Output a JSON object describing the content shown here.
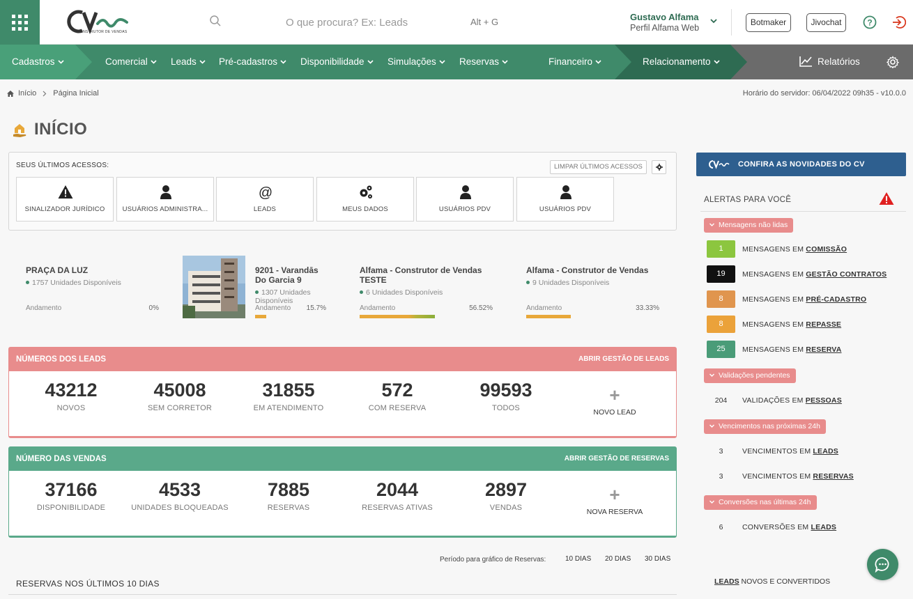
{
  "header": {
    "search_placeholder": "O que procura? Ex: Leads",
    "shortcut": "Alt + G",
    "user_name": "Gustavo Alfama",
    "user_profile": "Perfil Alfama Web",
    "botmaker_label": "Botmaker",
    "jivochat_label": "Jivochat",
    "logo_sub": "CONSTRUTOR DE VENDAS"
  },
  "nav": {
    "items": [
      "Cadastros",
      "Comercial",
      "Leads",
      "Pré-cadastros",
      "Disponibilidade",
      "Simulações",
      "Reservas",
      "Financeiro",
      "Relacionamento"
    ],
    "reports": "Relatórios",
    "colors": {
      "segment1": "#49a079",
      "segment2": "#3f8a6a",
      "segment3": "#2e6b52",
      "rest": "#6b6b6b"
    }
  },
  "breadcrumb": {
    "home": "Início",
    "current": "Página Inicial"
  },
  "server_time": "Horário do servidor: 06/04/2022 09h35 - v10.0.0",
  "page_title": "INÍCIO",
  "recent": {
    "title": "SEUS ÚLTIMOS ACESSOS:",
    "clear_label": "LIMPAR ÚLTIMOS ACESSOS",
    "tiles": [
      {
        "label": "SINALIZADOR JURÍDICO",
        "icon": "warning-icon"
      },
      {
        "label": "USUÁRIOS ADMINISTRA...",
        "icon": "user-icon"
      },
      {
        "label": "LEADS",
        "icon": "at-icon"
      },
      {
        "label": "MEUS DADOS",
        "icon": "gears-icon"
      },
      {
        "label": "USUÁRIOS PDV",
        "icon": "user-icon"
      },
      {
        "label": "USUÁRIOS PDV",
        "icon": "user-icon"
      }
    ]
  },
  "enterprises": [
    {
      "name": "PRAÇA DA LUZ",
      "units": "1757 Unidades Disponíveis",
      "progress_label": "Andamento",
      "progress_text": "0%",
      "progress": 0
    },
    {
      "name": "9201 - Varandās Do Garcia 9",
      "units": "1307 Unidades Disponíveis",
      "progress_label": "Andamento",
      "progress_text": "15.7%",
      "progress": 0.157
    },
    {
      "name": "Alfama - Construtor de Vendas TESTE",
      "units": "6 Unidades Disponíveis",
      "progress_label": "Andamento",
      "progress_text": "56.52%",
      "progress": 0.5652
    },
    {
      "name": "Alfama - Construtor de Vendas",
      "units": "9 Unidades Disponíveis",
      "progress_label": "Andamento",
      "progress_text": "33.33%",
      "progress": 0.3333
    }
  ],
  "leads_panel": {
    "title": "NÚMEROS DOS LEADS",
    "link": "ABRIR GESTÃO DE LEADS",
    "color": "#e88c8c",
    "stats": [
      {
        "value": "43212",
        "label": "NOVOS"
      },
      {
        "value": "45008",
        "label": "SEM CORRETOR"
      },
      {
        "value": "31855",
        "label": "EM ATENDIMENTO"
      },
      {
        "value": "572",
        "label": "COM RESERVA"
      },
      {
        "value": "99593",
        "label": "TODOS"
      }
    ],
    "add_label": "NOVO LEAD",
    "add_symbol": "+"
  },
  "sales_panel": {
    "title": "NÚMERO DAS VENDAS",
    "link": "ABRIR GESTÃO DE RESERVAS",
    "color": "#5aa98a",
    "stats": [
      {
        "value": "37166",
        "label": "DISPONIBILIDADE"
      },
      {
        "value": "4533",
        "label": "UNIDADES BLOQUEADAS"
      },
      {
        "value": "7885",
        "label": "RESERVAS"
      },
      {
        "value": "2044",
        "label": "RESERVAS ATIVAS"
      },
      {
        "value": "2897",
        "label": "VENDAS"
      }
    ],
    "add_label": "NOVA RESERVA",
    "add_symbol": "+"
  },
  "period": {
    "label": "Período para gráfico de Reservas:",
    "options": [
      "10 DIAS",
      "20 DIAS",
      "30 DIAS"
    ]
  },
  "reservations_title": "RESERVAS NOS ÚLTIMOS 10 DIAS",
  "sidebar": {
    "news_label": "CONFIRA AS NOVIDADES DO CV",
    "alerts_title": "ALERTAS PARA VOCÊ",
    "sections": [
      {
        "title": "Mensagens não lidas",
        "items": [
          {
            "count": "1",
            "prefix": "MENSAGENS EM",
            "link": "COMISSÃO",
            "color": "#8cc63f"
          },
          {
            "count": "19",
            "prefix": "MENSAGENS EM",
            "link": "GESTÃO CONTRATOS",
            "color": "#111111"
          },
          {
            "count": "8",
            "prefix": "MENSAGENS EM",
            "link": "PRÉ-CADASTRO",
            "color": "#e0954e"
          },
          {
            "count": "8",
            "prefix": "MENSAGENS EM",
            "link": "REPASSE",
            "color": "#eba23a"
          },
          {
            "count": "25",
            "prefix": "MENSAGENS EM",
            "link": "RESERVA",
            "color": "#4a9c78"
          }
        ]
      },
      {
        "title": "Validações pendentes",
        "items": [
          {
            "count": "204",
            "prefix": "VALIDAÇÕES EM",
            "link": "PESSOAS"
          }
        ]
      },
      {
        "title": "Vencimentos nas próximas 24h",
        "items": [
          {
            "count": "3",
            "prefix": "VENCIMENTOS EM",
            "link": "LEADS"
          },
          {
            "count": "3",
            "prefix": "VENCIMENTOS EM",
            "link": "RESERVAS"
          }
        ]
      },
      {
        "title": "Conversões nas últimas 24h",
        "items": [
          {
            "count": "6",
            "prefix": "CONVERSÕES EM",
            "link": "LEADS"
          }
        ]
      }
    ],
    "footer_link": "LEADS",
    "footer_text": " NOVOS E CONVERTIDOS"
  }
}
